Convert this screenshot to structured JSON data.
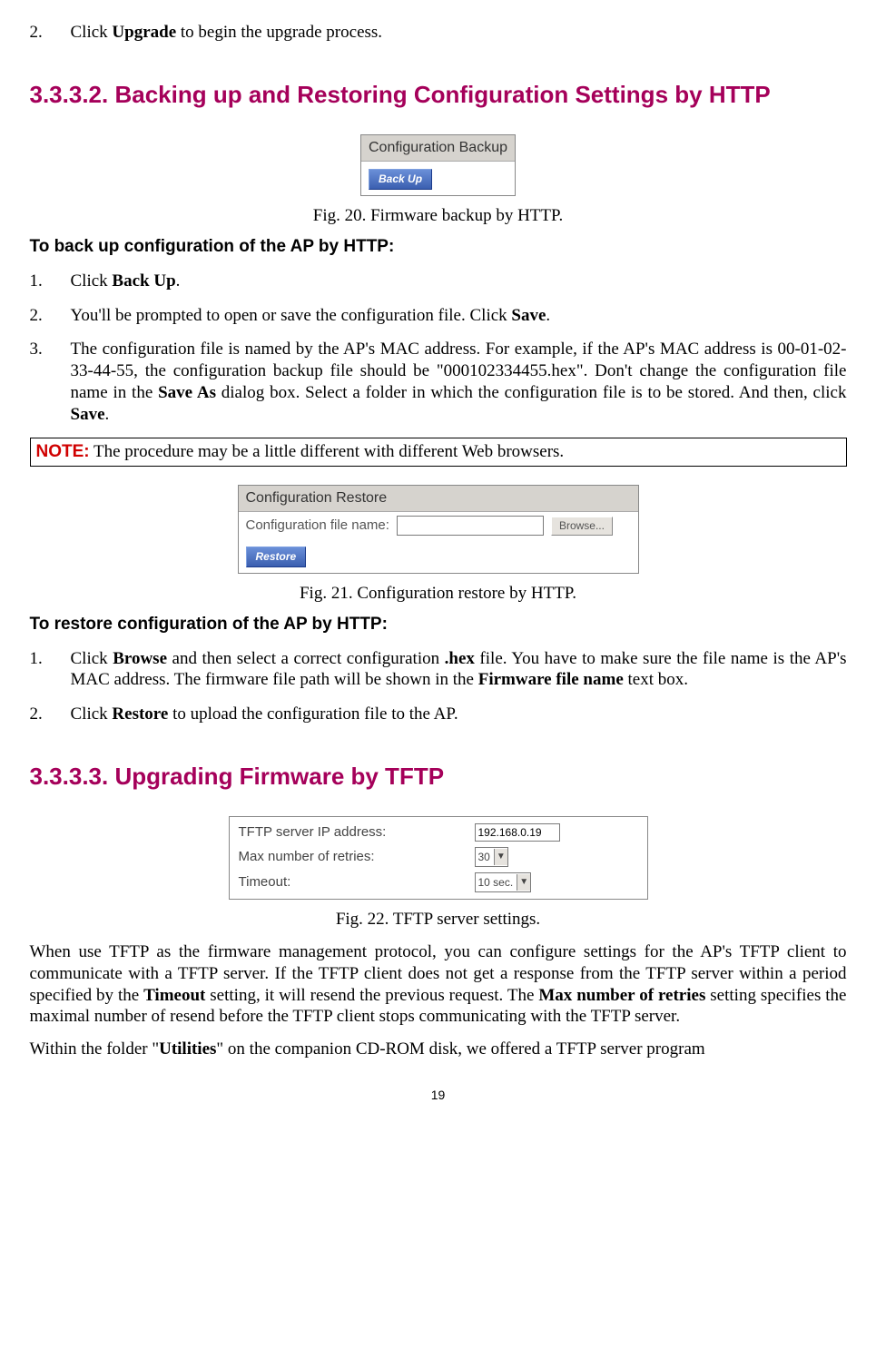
{
  "top_step": {
    "num": "2.",
    "pre": "Click ",
    "b": "Upgrade",
    "post": " to begin the upgrade process."
  },
  "sec1": {
    "title": "3.3.3.2. Backing up and Restoring Configuration Settings by HTTP",
    "fig20": {
      "header": "Configuration Backup",
      "button": "Back Up",
      "caption": "Fig. 20. Firmware backup by HTTP."
    },
    "backup_head": "To back up configuration of the AP by HTTP:",
    "b1": {
      "num": "1.",
      "pre": "Click ",
      "b": "Back Up",
      "post": "."
    },
    "b2": {
      "num": "2.",
      "pre": "You'll be prompted to open or save the configuration file. Click ",
      "b": "Save",
      "post": "."
    },
    "b3": {
      "num": "3.",
      "pre": "The configuration file is named by the AP's MAC address. For example, if the AP's MAC address is 00-01-02-33-44-55, the configuration backup file should be \"000102334455.hex\". Don't change the configuration file name in the ",
      "b": "Save As",
      "mid": " dialog box. Select a folder in which the configuration file is to be stored. And then, click ",
      "b2": "Save",
      "post": "."
    },
    "note": {
      "label": "NOTE:",
      "text": " The procedure may be a little different with different Web browsers."
    },
    "fig21": {
      "header": "Configuration Restore",
      "label": "Configuration file name:",
      "browse": "Browse...",
      "button": "Restore",
      "caption": "Fig. 21. Configuration restore by HTTP."
    },
    "restore_head": "To restore configuration of the AP by HTTP:",
    "r1": {
      "num": "1.",
      "pre": "Click ",
      "b": "Browse",
      "mid": " and then select a correct configuration ",
      "b2": ".hex",
      "mid2": " file. You have to make sure the file name is the AP's MAC address. The firmware file path will be shown in the ",
      "b3": "Firmware file name",
      "post": " text box."
    },
    "r2": {
      "num": "2.",
      "pre": "Click ",
      "b": "Restore",
      "post": " to upload the configuration file to the AP."
    }
  },
  "sec2": {
    "title": "3.3.3.3. Upgrading Firmware by TFTP",
    "fig22": {
      "rows": [
        {
          "label": "TFTP server IP address:",
          "value": "192.168.0.19",
          "type": "text"
        },
        {
          "label": "Max number of retries:",
          "value": "30",
          "type": "select"
        },
        {
          "label": "Timeout:",
          "value": "10 sec.",
          "type": "select"
        }
      ],
      "caption": "Fig. 22. TFTP server settings."
    },
    "para1": {
      "t1": "When use TFTP as the firmware management protocol, you can configure settings for the AP's TFTP client to communicate with a TFTP server. If the TFTP client does not get a response from the TFTP server within a period specified by the ",
      "b1": "Timeout",
      "t2": " setting, it will resend the previous request. The ",
      "b2": "Max number of retries",
      "t3": " setting specifies the maximal number of resend before the TFTP client stops communicating with the TFTP server."
    },
    "para2": {
      "t1": "Within the folder \"",
      "b1": "Utilities",
      "t2": "\" on the companion CD-ROM disk, we offered a TFTP server program"
    }
  },
  "page": "19"
}
